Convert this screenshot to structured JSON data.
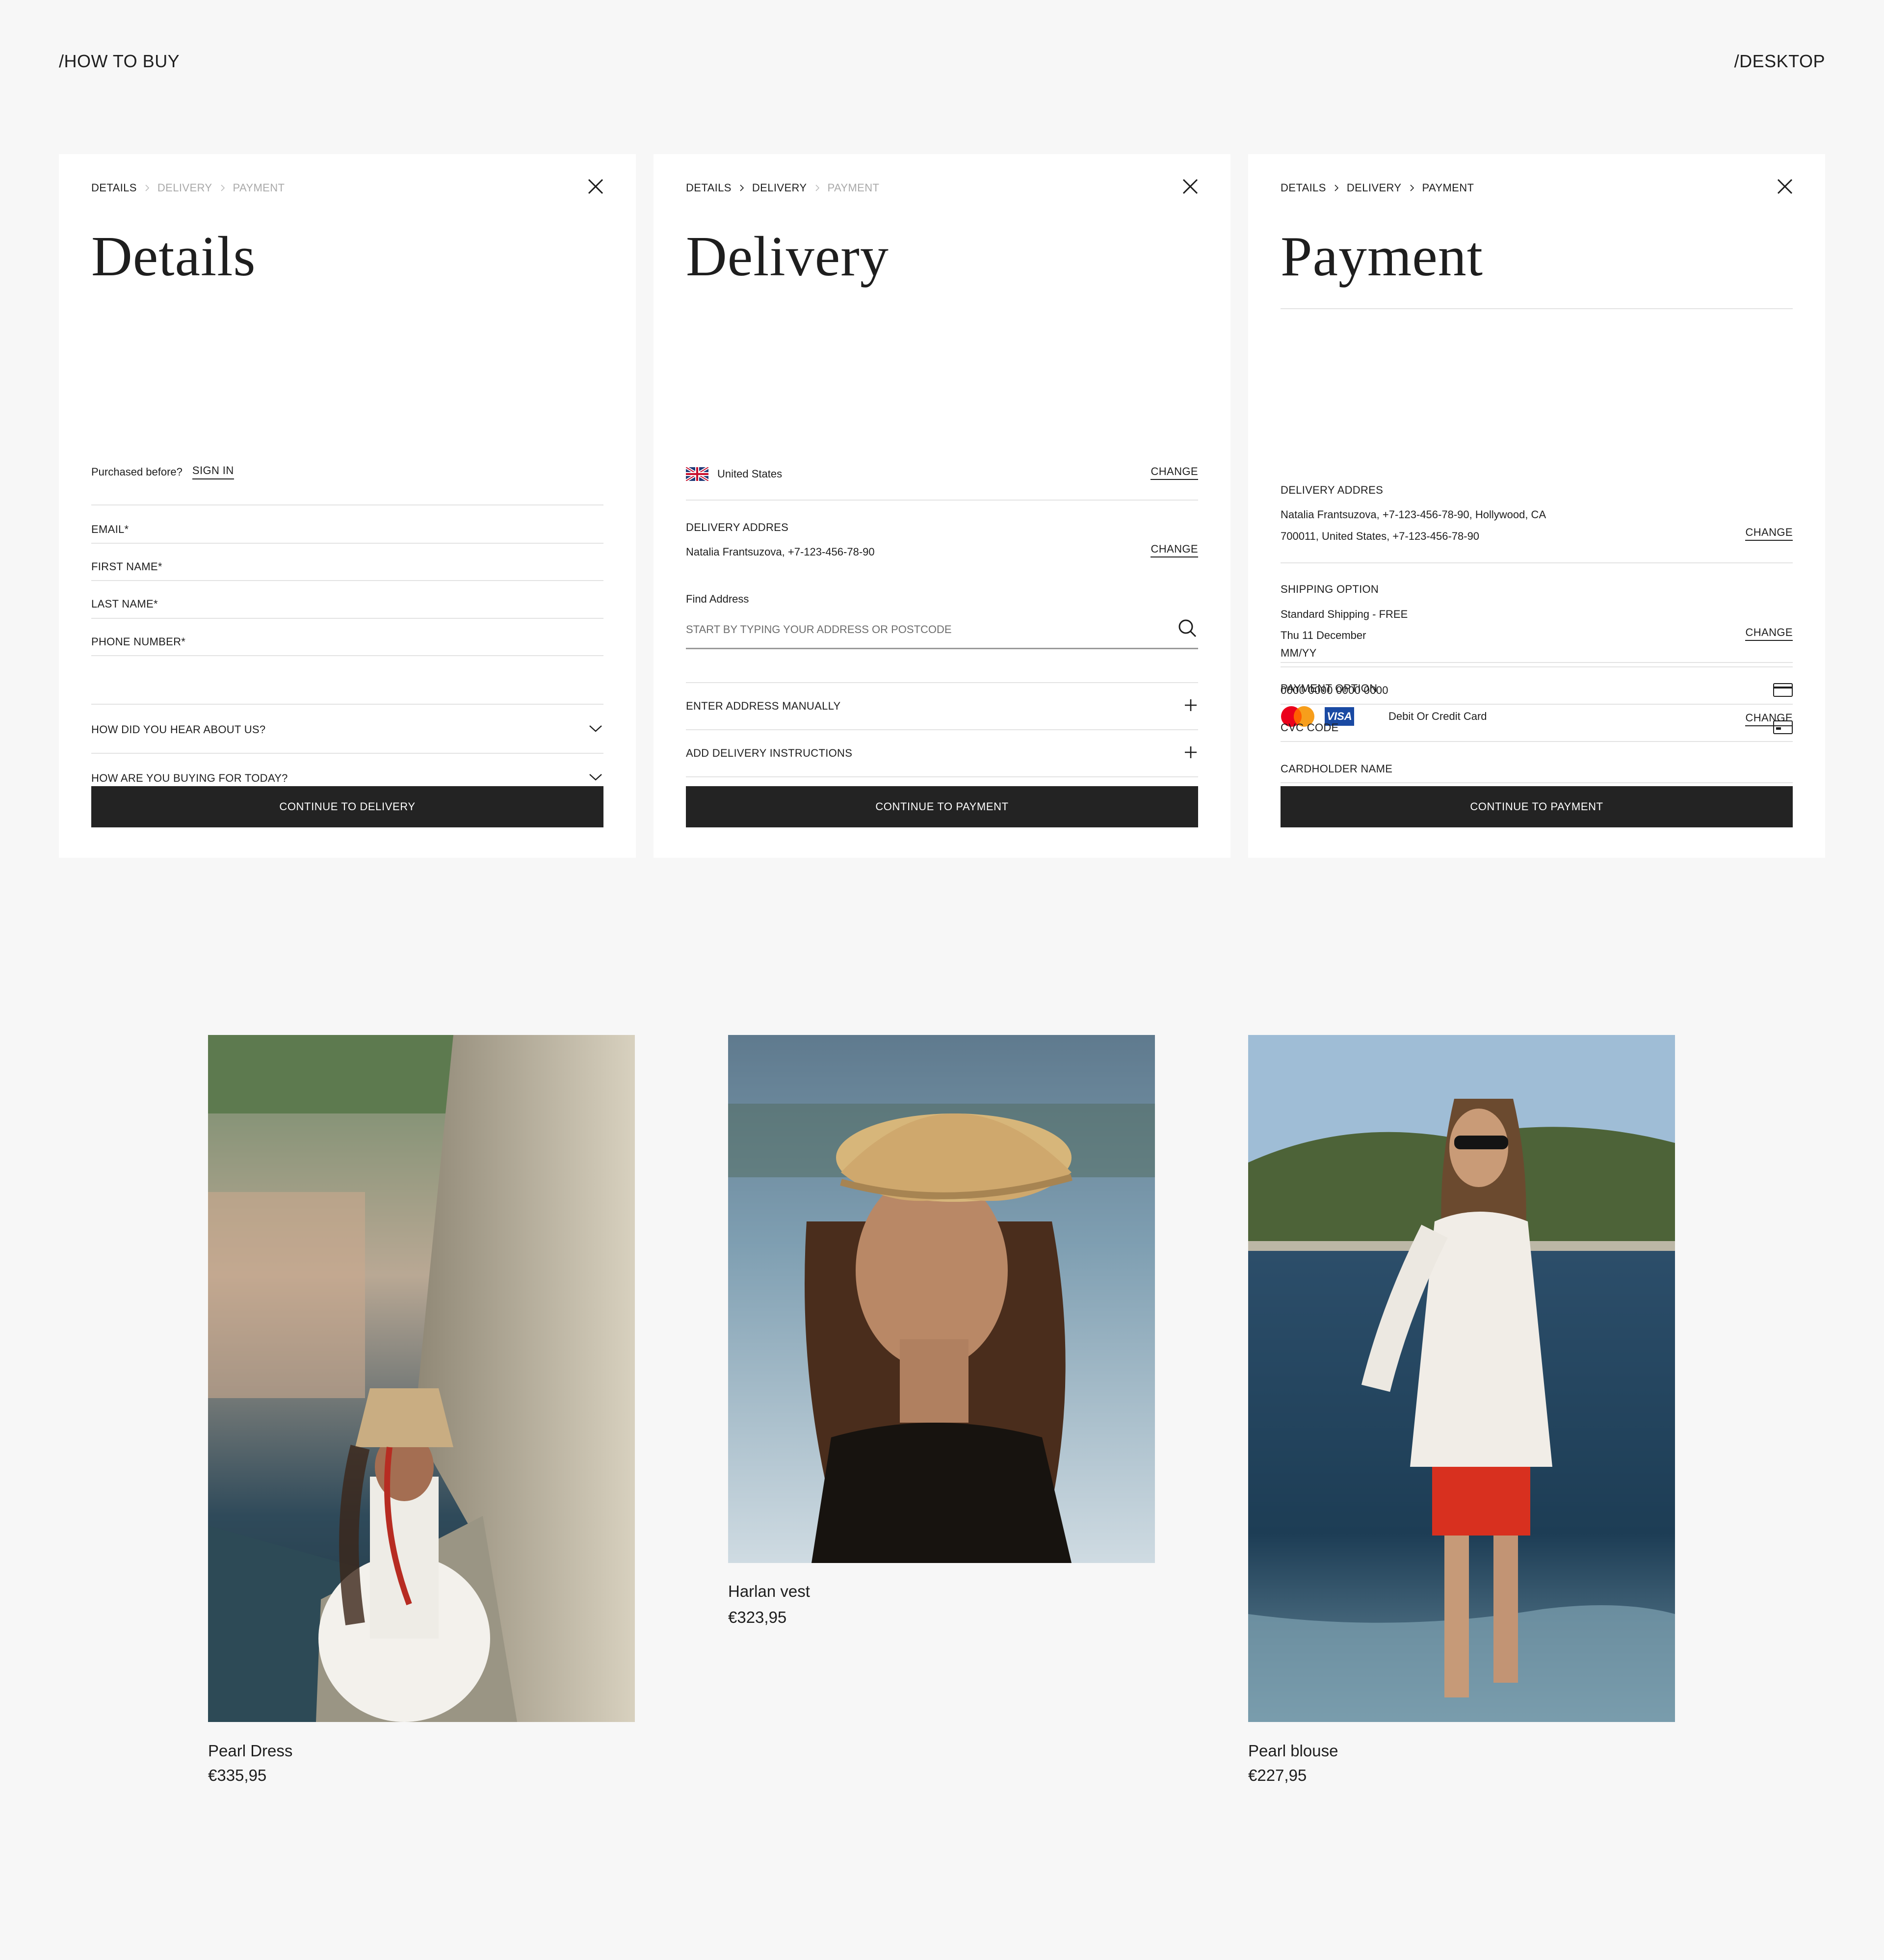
{
  "header": {
    "left_label": "/HOW TO BUY",
    "right_label": "/DESKTOP"
  },
  "breadcrumb": {
    "details": "DETAILS",
    "delivery": "DELIVERY",
    "payment": "PAYMENT"
  },
  "details_panel": {
    "title": "Details",
    "purchased_before": "Purchased before?",
    "sign_in": "SIGN IN",
    "fields": [
      "EMAIL*",
      "FIRST NAME*",
      "LAST NAME*",
      "PHONE NUMBER*"
    ],
    "dropdowns": [
      "HOW DID YOU HEAR ABOUT US?",
      "HOW ARE YOU BUYING FOR TODAY?"
    ],
    "cta": "CONTINUE TO DELIVERY"
  },
  "delivery_panel": {
    "title": "Delivery",
    "country": "United States",
    "change": "CHANGE",
    "address_heading": "DELIVERY ADDRES",
    "address_value": "Natalia Frantsuzova, +7-123-456-78-90",
    "find_address_label": "Find Address",
    "find_address_placeholder": "START BY TYPING YOUR ADDRESS OR POSTCODE",
    "expanders": [
      "ENTER ADDRESS MANUALLY",
      "ADD DELIVERY INSTRUCTIONS"
    ],
    "cta": "CONTINUE TO PAYMENT"
  },
  "payment_panel": {
    "title": "Payment",
    "change": "CHANGE",
    "address_heading": "DELIVERY ADDRES",
    "address_line1": "Natalia Frantsuzova, +7-123-456-78-90, Hollywood, CA",
    "address_line2": "700011, United States, +7-123-456-78-90",
    "shipping_heading": "SHIPPING OPTION",
    "shipping_line1": "Standard Shipping - FREE",
    "shipping_line2": "Thu 11 December",
    "payment_heading": "PAYMENT OPTION",
    "visa_label": "VISA",
    "payment_method": "Debit Or Credit Card",
    "card_fields": [
      "CARDHOLDER NAME",
      "MM/YY",
      "0000 0000 0000 0000",
      "CVC CODE"
    ],
    "cta": "CONTINUE TO PAYMENT"
  },
  "products": [
    {
      "name": "Pearl Dress",
      "price": "€335,95"
    },
    {
      "name": "Harlan vest",
      "price": "€323,95"
    },
    {
      "name": "Pearl blouse",
      "price": "€227,95"
    }
  ],
  "colors": {
    "page_bg": "#f7f7f7",
    "panel_bg": "#ffffff",
    "cta_bg": "#232323",
    "text": "#1e1e1e",
    "inactive": "#a9a9a9"
  }
}
